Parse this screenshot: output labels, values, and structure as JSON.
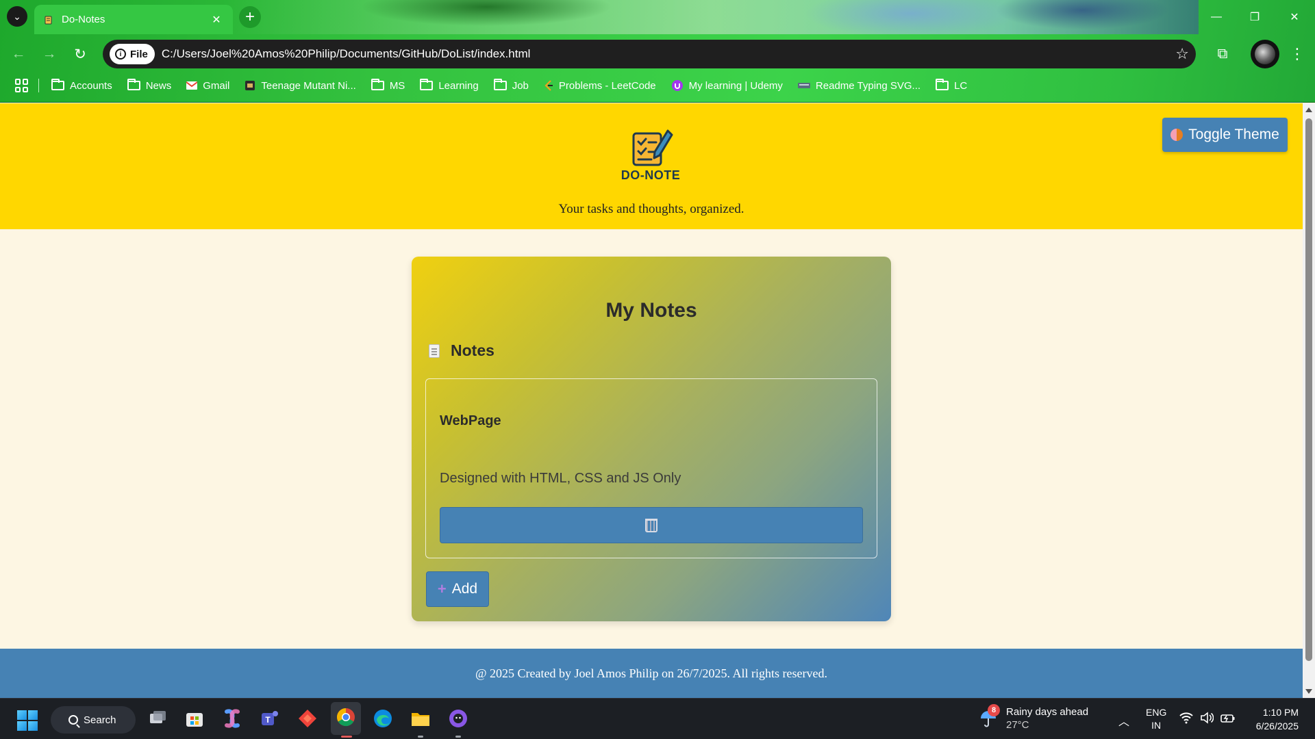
{
  "browser": {
    "tab": {
      "title": "Do-Notes",
      "close_glyph": "✕"
    },
    "new_tab_glyph": "+",
    "window_controls": {
      "minimize": "—",
      "restore": "❐",
      "close": "✕"
    },
    "nav": {
      "back": "←",
      "forward": "→",
      "reload": "↻"
    },
    "omnibox": {
      "chip_label": "File",
      "url": "C:/Users/Joel%20Amos%20Philip/Documents/GitHub/DoList/index.html"
    },
    "bookmarks": [
      {
        "label": "Accounts",
        "icon": "folder-icon"
      },
      {
        "label": "News",
        "icon": "folder-icon"
      },
      {
        "label": "Gmail",
        "icon": "gmail-icon"
      },
      {
        "label": "Teenage Mutant Ni...",
        "icon": "site-icon"
      },
      {
        "label": "MS",
        "icon": "folder-icon"
      },
      {
        "label": "Learning",
        "icon": "folder-icon"
      },
      {
        "label": "Job",
        "icon": "folder-icon"
      },
      {
        "label": "Problems - LeetCode",
        "icon": "leetcode-icon"
      },
      {
        "label": "My learning | Udemy",
        "icon": "udemy-icon"
      },
      {
        "label": "Readme Typing SVG...",
        "icon": "typing-icon"
      },
      {
        "label": "LC",
        "icon": "folder-icon"
      }
    ]
  },
  "site": {
    "logo_text": "DO-NOTE",
    "tagline": "Your tasks and thoughts, organized.",
    "theme_button": "Toggle Theme",
    "card": {
      "title": "My Notes",
      "section_heading": "Notes",
      "notes": [
        {
          "title": "WebPage",
          "body": "Designed with HTML, CSS and JS Only"
        }
      ],
      "add_button": "Add"
    },
    "footer": "@ 2025 Created by Joel Amos Philip on 26/7/2025. All rights reserved."
  },
  "taskbar": {
    "search_label": "Search",
    "weather": {
      "badge": "8",
      "headline": "Rainy days ahead",
      "temp": "27°C"
    },
    "language": {
      "line1": "ENG",
      "line2": "IN"
    },
    "clock": {
      "time": "1:10 PM",
      "date": "6/26/2025"
    }
  },
  "colors": {
    "header_yellow": "#ffd700",
    "accent_blue": "#4682b4",
    "page_background": "#fdf6e3",
    "chrome_green": "#34c23f"
  }
}
